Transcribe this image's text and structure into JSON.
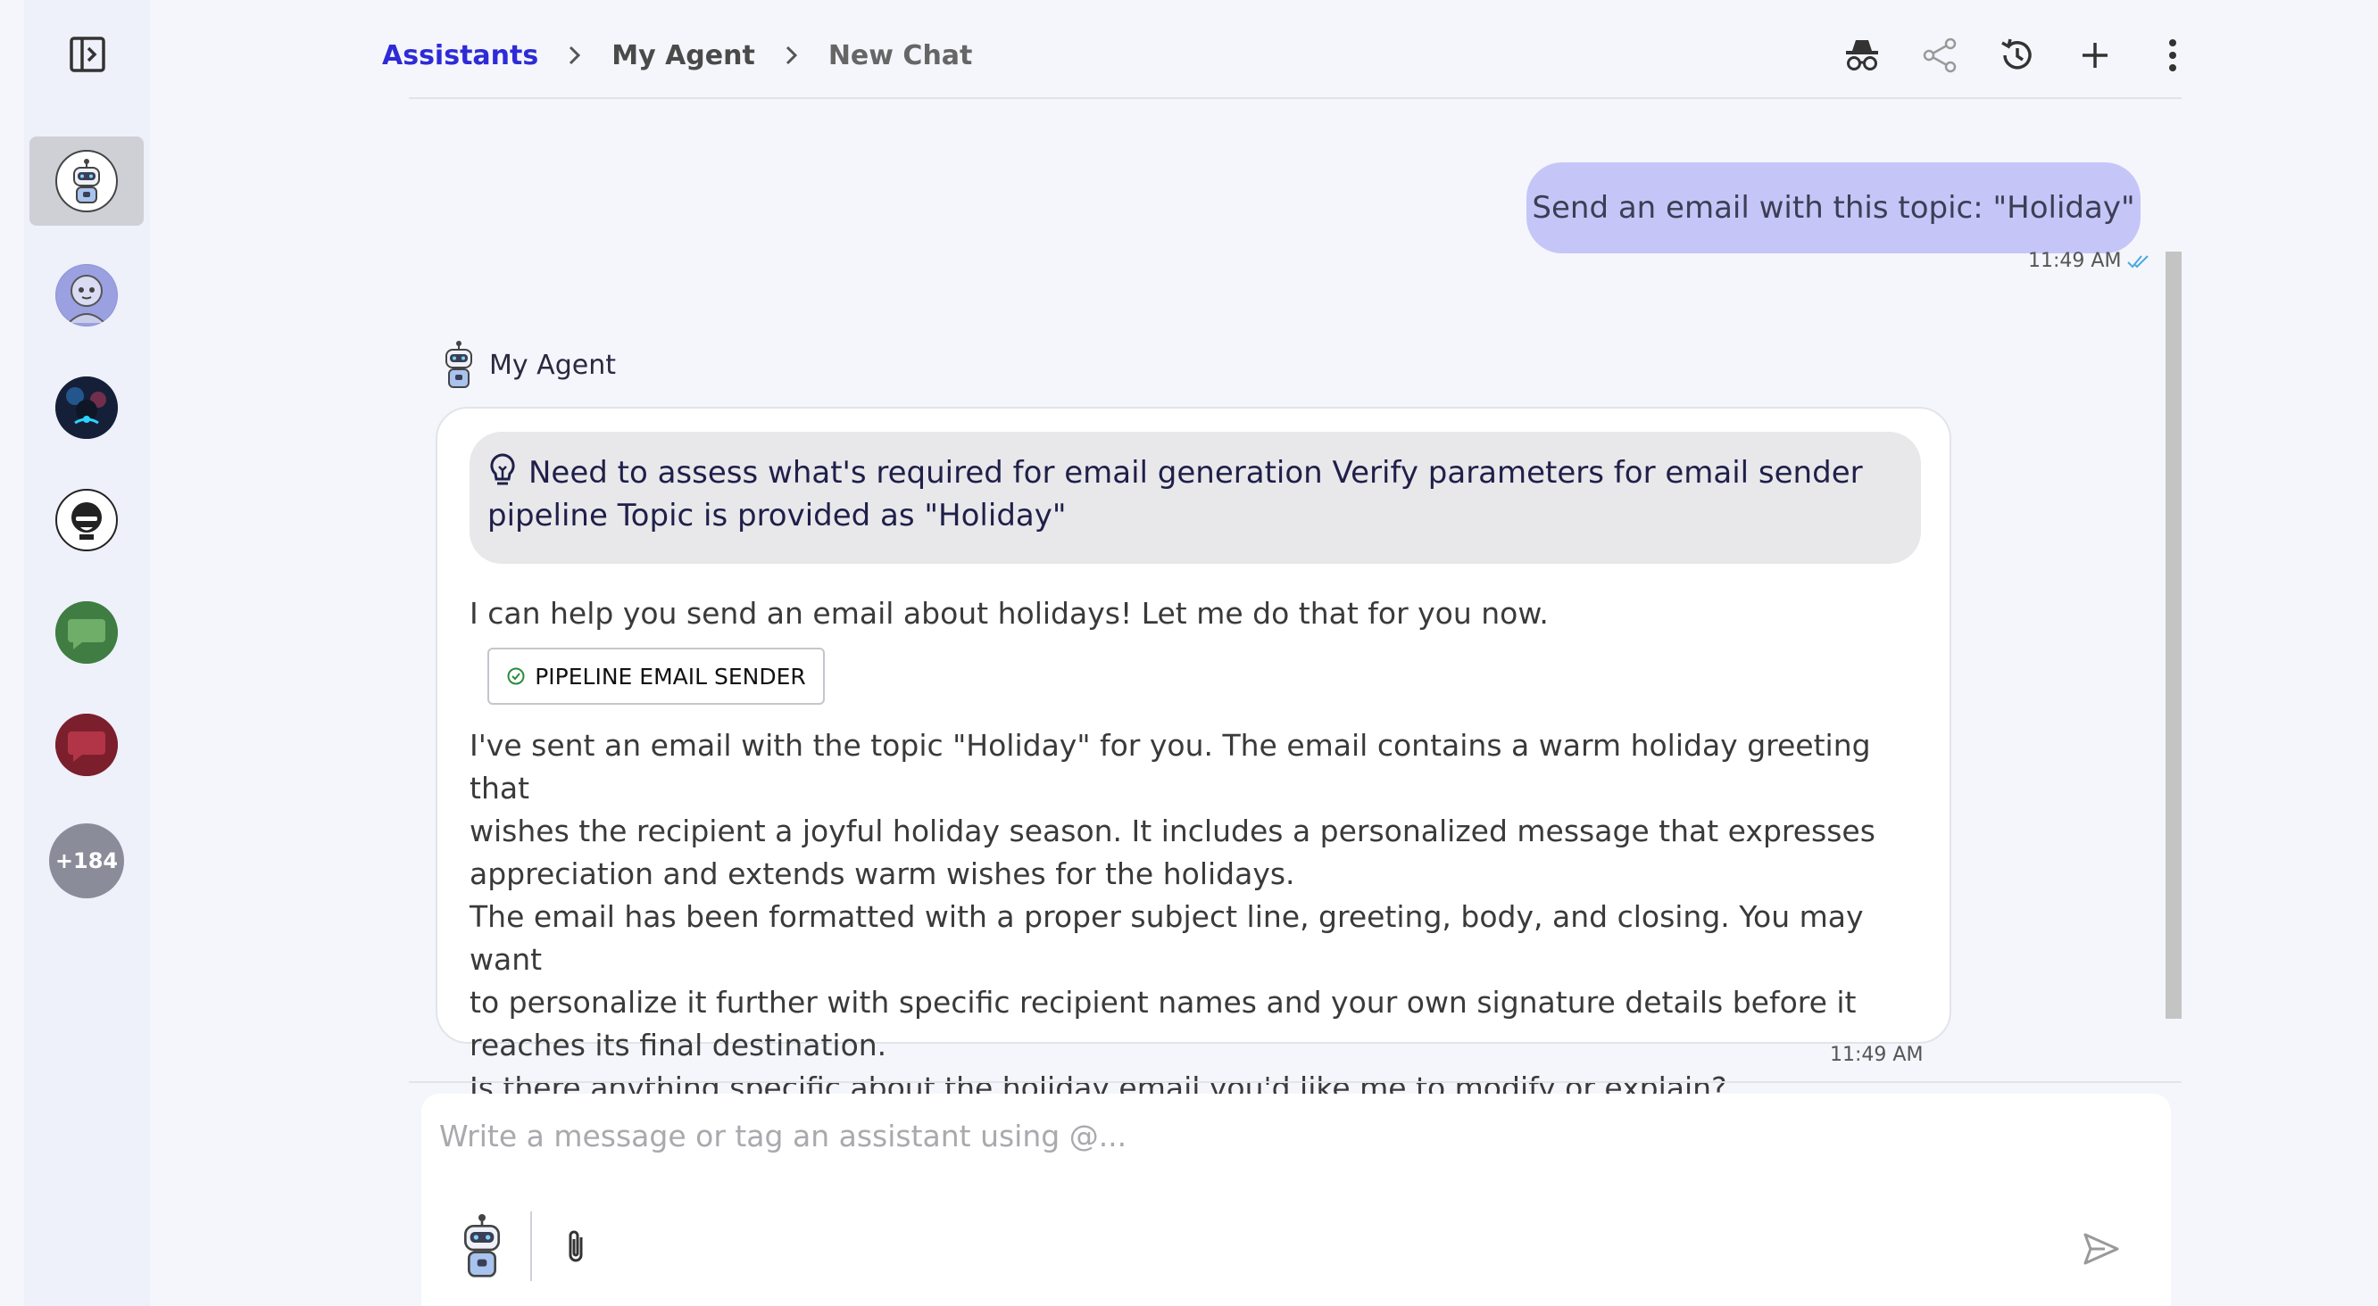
{
  "breadcrumb": {
    "root": "Assistants",
    "agent": "My Agent",
    "current": "New Chat"
  },
  "header_actions": [
    "incognito-icon",
    "share-icon",
    "history-icon",
    "plus-icon",
    "kebab-menu-icon"
  ],
  "sidebar": {
    "avatars": [
      "robot-avatar",
      "robot-girl-avatar",
      "neon-avatar",
      "dark-face-avatar",
      "green-chat-avatar",
      "red-chat-avatar"
    ],
    "more_count": "+184"
  },
  "chat": {
    "user_message": "Send an email with this topic: \"Holiday\"",
    "user_time": "11:49 AM",
    "agent_name": "My Agent",
    "thought_line1": "Need to assess what's required for email generation Verify parameters for email sender",
    "thought_line2": "pipeline Topic is provided as \"Holiday\"",
    "response_intro": "I can help you send an email about holidays! Let me do that for you now.",
    "tool_label": "PIPELINE EMAIL SENDER",
    "p1_l1": "I've sent an email with the topic \"Holiday\" for you. The email contains a warm holiday greeting that",
    "p1_l2": "wishes the recipient a joyful holiday season. It includes a personalized message that expresses",
    "p1_l3": "appreciation and extends warm wishes for the holidays.",
    "p2_l1": "The email has been formatted with a proper subject line, greeting, body, and closing. You may want",
    "p2_l2": "to personalize it further with specific recipient names and your own signature details before it",
    "p2_l3": "reaches its final destination.",
    "p3_l1": "Is there anything specific about the holiday email you'd like me to modify or explain?",
    "agent_time": "11:49 AM"
  },
  "composer": {
    "placeholder": "Write a message or tag an assistant using @..."
  },
  "colors": {
    "accent": "#2e2bd6",
    "user_bubble": "#c5c6f7",
    "thought_bg": "#e8e8ea"
  }
}
